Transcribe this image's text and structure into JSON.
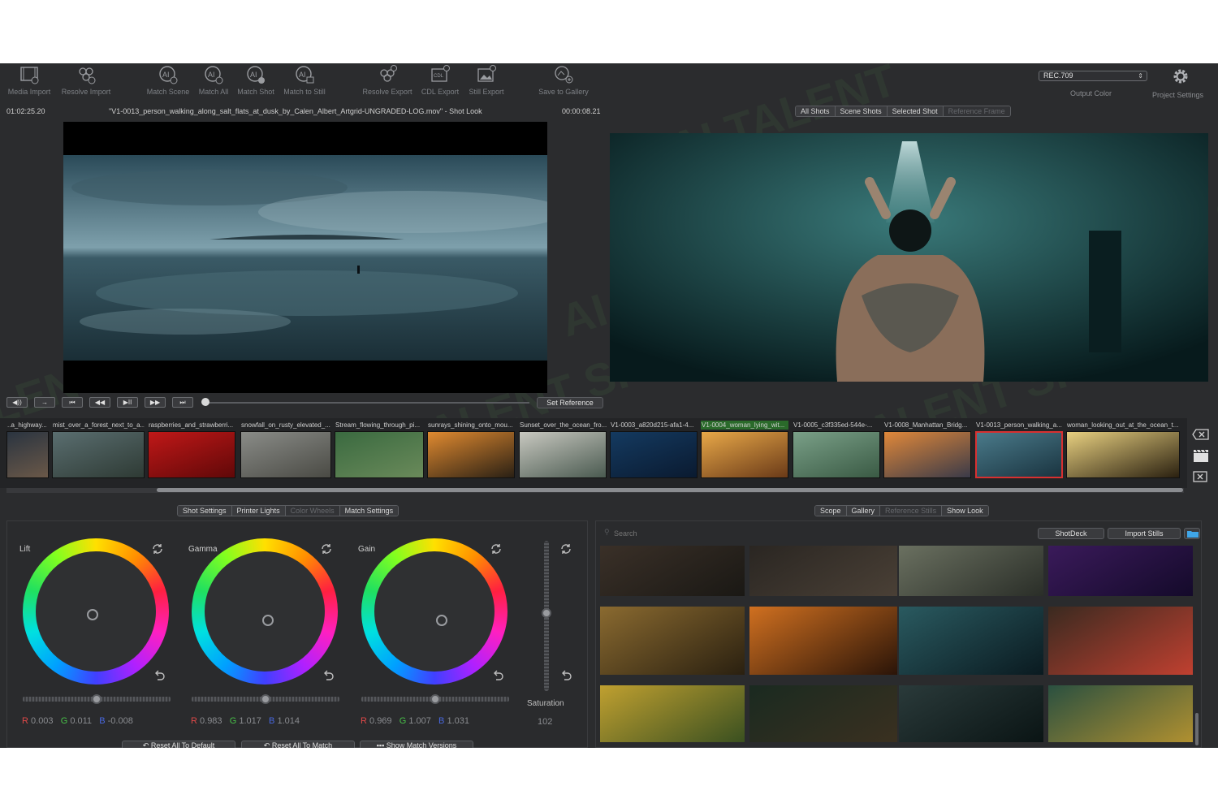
{
  "toolbar": {
    "left": [
      {
        "label": "Media Import",
        "icon": "film-import-icon"
      },
      {
        "label": "Resolve Import",
        "icon": "resolve-import-icon"
      },
      {
        "label": "Match Scene",
        "icon": "ai-match-scene-icon"
      },
      {
        "label": "Match All",
        "icon": "ai-match-all-icon"
      },
      {
        "label": "Match Shot",
        "icon": "ai-match-shot-icon"
      },
      {
        "label": "Match to Still",
        "icon": "ai-match-still-icon"
      },
      {
        "label": "Resolve Export",
        "icon": "resolve-export-icon"
      },
      {
        "label": "CDL Export",
        "icon": "cdl-export-icon"
      },
      {
        "label": "Still Export",
        "icon": "still-export-icon"
      },
      {
        "label": "Save to Gallery",
        "icon": "save-gallery-icon"
      }
    ],
    "output_color_value": "REC.709",
    "output_color_label": "Output Color",
    "project_settings_label": "Project Settings"
  },
  "viewer": {
    "timecode_left": "01:02:25.20",
    "clip_title": "\"V1-0013_person_walking_along_salt_flats_at_dusk_by_Calen_Albert_Artgrid-UNGRADED-LOG.mov\" - Shot Look",
    "timecode_right": "00:00:08.21",
    "set_reference": "Set Reference",
    "transport": [
      "◀))",
      "→",
      "⏮",
      "◀◀",
      "▶II",
      "▶▶",
      "⏭"
    ],
    "progress_fraction": 0.0
  },
  "reference_tabs": [
    {
      "label": "All Shots",
      "active": true
    },
    {
      "label": "Scene Shots",
      "active": true
    },
    {
      "label": "Selected Shot",
      "active": true
    },
    {
      "label": "Reference Frame",
      "active": false
    }
  ],
  "thumbnails": [
    {
      "title": "..a_highway...",
      "c1": "#2a3440",
      "c2": "#6a5848"
    },
    {
      "title": "mist_over_a_forest_next_to_a...",
      "c1": "#5a6e70",
      "c2": "#2e3a34"
    },
    {
      "title": "raspberries_and_strawberri...",
      "c1": "#c01818",
      "c2": "#600808"
    },
    {
      "title": "snowfall_on_rusty_elevated_...",
      "c1": "#8a8c88",
      "c2": "#4a4a44"
    },
    {
      "title": "Stream_flowing_through_pi...",
      "c1": "#3a6a40",
      "c2": "#6a8a5a"
    },
    {
      "title": "sunrays_shining_onto_mou...",
      "c1": "#e08a30",
      "c2": "#2a2014"
    },
    {
      "title": "Sunset_over_the_ocean_fro...",
      "c1": "#c8c8c0",
      "c2": "#4a5a50"
    },
    {
      "title": "V1-0003_a820d215-afa1-4...",
      "c1": "#143a60",
      "c2": "#0a1a30"
    },
    {
      "title": "V1-0004_woman_lying_wit...",
      "c1": "#e8a848",
      "c2": "#6a3a18"
    },
    {
      "title": "V1-0005_c3f335ed-544e-...",
      "c1": "#7aa088",
      "c2": "#3a5a44"
    },
    {
      "title": "V1-0008_Manhattan_Bridg...",
      "c1": "#e0883a",
      "c2": "#3a3a48"
    },
    {
      "title": "V1-0013_person_walking_a...",
      "c1": "#4a7a8a",
      "c2": "#1a3440"
    },
    {
      "title": "woman_looking_out_at_the_ocean_t...",
      "c1": "#e8d080",
      "c2": "#2a2010"
    }
  ],
  "left_tabs": [
    {
      "label": "Shot Settings",
      "active": true
    },
    {
      "label": "Printer Lights",
      "active": true
    },
    {
      "label": "Color Wheels",
      "active": false
    },
    {
      "label": "Match Settings",
      "active": true
    }
  ],
  "wheels": [
    {
      "title": "Lift",
      "r": "0.003",
      "g": "0.011",
      "b": "-0.008",
      "knob_x": 0.48,
      "knob_y": 0.52,
      "slider": 0.5
    },
    {
      "title": "Gamma",
      "r": "0.983",
      "g": "1.017",
      "b": "1.014",
      "knob_x": 0.52,
      "knob_y": 0.56,
      "slider": 0.5
    },
    {
      "title": "Gain",
      "r": "0.969",
      "g": "1.007",
      "b": "1.031",
      "knob_x": 0.55,
      "knob_y": 0.56,
      "slider": 0.5
    }
  ],
  "saturation": {
    "label": "Saturation",
    "value": "102",
    "level": 0.52
  },
  "bottom_buttons": [
    {
      "label": "↶ Reset All To Default"
    },
    {
      "label": "↶ Reset All To Match"
    },
    {
      "label": "▪▪▪ Show Match Versions"
    }
  ],
  "right_tabs": [
    {
      "label": "Scope",
      "active": true
    },
    {
      "label": "Gallery",
      "active": true
    },
    {
      "label": "Reference Stills",
      "active": false
    },
    {
      "label": "Show Look",
      "active": true
    }
  ],
  "search_placeholder": "Search",
  "shotdeck_label": "ShotDeck",
  "import_stills_label": "Import Stills",
  "gallery": [
    {
      "c1": "#3a3028",
      "c2": "#1a1814"
    },
    {
      "c1": "#2a2622",
      "c2": "#4a4036"
    },
    {
      "c1": "#6a7060",
      "c2": "#2a2e28"
    },
    {
      "c1": "#3a1a5a",
      "c2": "#140a2a"
    },
    {
      "c1": "#8a6a30",
      "c2": "#2a2010"
    },
    {
      "c1": "#d07020",
      "c2": "#2a1408"
    },
    {
      "c1": "#2a5a60",
      "c2": "#0a1a20"
    },
    {
      "c1": "#3a2a20",
      "c2": "#c04030"
    },
    {
      "c1": "#c0a030",
      "c2": "#3a5020"
    },
    {
      "c1": "#1a2a20",
      "c2": "#3a3020"
    },
    {
      "c1": "#2a3a3a",
      "c2": "#0a1414"
    },
    {
      "c1": "#2a5040",
      "c2": "#b09030"
    }
  ]
}
